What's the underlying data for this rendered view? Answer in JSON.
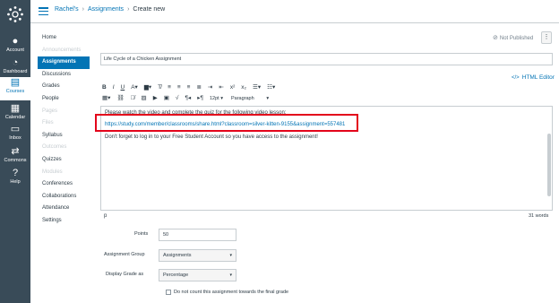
{
  "global_nav": {
    "items": [
      {
        "label": "Account",
        "icon": "account-icon"
      },
      {
        "label": "Dashboard",
        "icon": "dashboard-icon"
      },
      {
        "label": "Courses",
        "icon": "courses-icon"
      },
      {
        "label": "Calendar",
        "icon": "calendar-icon"
      },
      {
        "label": "Inbox",
        "icon": "inbox-icon"
      },
      {
        "label": "Commons",
        "icon": "commons-icon"
      },
      {
        "label": "Help",
        "icon": "help-icon"
      }
    ],
    "active": "Courses"
  },
  "header": {
    "breadcrumb": [
      "Rachel's",
      "Assignments",
      "Create new"
    ]
  },
  "course_nav": {
    "items": [
      "Home",
      "Announcements",
      "Assignments",
      "Discussions",
      "Grades",
      "People",
      "Pages",
      "Files",
      "Syllabus",
      "Outcomes",
      "Quizzes",
      "Modules",
      "Conferences",
      "Collaborations",
      "Attendance",
      "Settings"
    ],
    "active": "Assignments"
  },
  "publish": {
    "status": "Not Published"
  },
  "assignment": {
    "title": "Life Cycle of a Chicken Assignment",
    "html_editor_label": "HTML Editor"
  },
  "toolbar": {
    "font_size": "12pt",
    "paragraph": "Paragraph"
  },
  "editor": {
    "line1": "Please watch the video and complete the quiz for the following video lesson:",
    "link": "https://study.com/member/classrooms/share.html?classroom=silver-kitten-9155&assignment=557481",
    "line3": "Don't forget to log in to your Free Student Account so you have access to the assignment!",
    "path": "p",
    "word_count": "31 words"
  },
  "form": {
    "points_label": "Points",
    "points_value": "50",
    "group_label": "Assignment Group",
    "group_value": "Assignments",
    "display_label": "Display Grade as",
    "display_value": "Percentage",
    "no_count_label": "Do not count this assignment towards the final grade"
  },
  "colors": {
    "nav_bg": "#394b58",
    "accent": "#0374b5",
    "highlight": "#e3051b"
  }
}
